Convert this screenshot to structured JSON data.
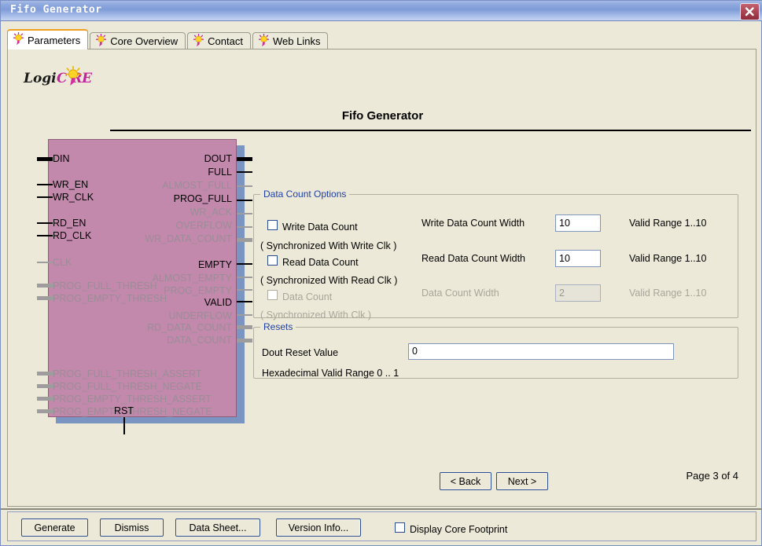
{
  "window": {
    "title": "Fifo Generator",
    "close_icon": "close-icon"
  },
  "tabs": [
    {
      "label": "Parameters",
      "icon": "bulb-icon",
      "selected": true
    },
    {
      "label": "Core Overview",
      "icon": "bulb-icon",
      "selected": false
    },
    {
      "label": "Contact",
      "icon": "bulb-icon",
      "selected": false
    },
    {
      "label": "Web Links",
      "icon": "bulb-icon",
      "selected": false
    }
  ],
  "logo": {
    "part1": "Logi",
    "part2": "C RE"
  },
  "header": {
    "title": "Fifo Generator"
  },
  "diagram": {
    "inputs": [
      {
        "label": "DIN",
        "enabled": true,
        "bus": true
      },
      {
        "label": "WR_EN",
        "enabled": true,
        "bus": false
      },
      {
        "label": "WR_CLK",
        "enabled": true,
        "bus": false
      },
      {
        "label": "RD_EN",
        "enabled": true,
        "bus": false
      },
      {
        "label": "RD_CLK",
        "enabled": true,
        "bus": false
      },
      {
        "label": "CLK",
        "enabled": false,
        "bus": false
      },
      {
        "label": "PROG_FULL_THRESH",
        "enabled": false,
        "bus": true
      },
      {
        "label": "PROG_EMPTY_THRESH",
        "enabled": false,
        "bus": true
      },
      {
        "label": "PROG_FULL_THRESH_ASSERT",
        "enabled": false,
        "bus": true
      },
      {
        "label": "PROG_FULL_THRESH_NEGATE",
        "enabled": false,
        "bus": true
      },
      {
        "label": "PROG_EMPTY_THRESH_ASSERT",
        "enabled": false,
        "bus": true
      },
      {
        "label": "PROG_EMPTY_THRESH_NEGATE",
        "enabled": false,
        "bus": true
      }
    ],
    "outputs": [
      {
        "label": "DOUT",
        "enabled": true,
        "bus": true
      },
      {
        "label": "FULL",
        "enabled": true,
        "bus": false
      },
      {
        "label": "ALMOST_FULL",
        "enabled": false,
        "bus": false
      },
      {
        "label": "PROG_FULL",
        "enabled": true,
        "bus": false
      },
      {
        "label": "WR_ACK",
        "enabled": false,
        "bus": false
      },
      {
        "label": "OVERFLOW",
        "enabled": false,
        "bus": false
      },
      {
        "label": "WR_DATA_COUNT",
        "enabled": false,
        "bus": true
      },
      {
        "label": "EMPTY",
        "enabled": true,
        "bus": false
      },
      {
        "label": "ALMOST_EMPTY",
        "enabled": false,
        "bus": false
      },
      {
        "label": "PROG_EMPTY",
        "enabled": false,
        "bus": false
      },
      {
        "label": "VALID",
        "enabled": true,
        "bus": false
      },
      {
        "label": "UNDERFLOW",
        "enabled": false,
        "bus": false
      },
      {
        "label": "RD_DATA_COUNT",
        "enabled": false,
        "bus": true
      },
      {
        "label": "DATA_COUNT",
        "enabled": false,
        "bus": true
      }
    ],
    "reset_pin": "RST"
  },
  "data_count_options": {
    "title": "Data Count Options",
    "write_data_count": {
      "checkbox_label": "Write Data Count",
      "checked": false,
      "enabled": true,
      "sync_note": "( Synchronized With Write Clk )",
      "width_label": "Write Data Count Width",
      "width_value": "10",
      "range_label": "Valid Range 1..10"
    },
    "read_data_count": {
      "checkbox_label": "Read Data Count",
      "checked": false,
      "enabled": true,
      "sync_note": "( Synchronized With Read Clk )",
      "width_label": "Read Data Count Width",
      "width_value": "10",
      "range_label": "Valid Range 1..10"
    },
    "data_count": {
      "checkbox_label": "Data Count",
      "checked": false,
      "enabled": false,
      "sync_note": "( Synchronized With Clk )",
      "width_label": "Data Count Width",
      "width_value": "2",
      "range_label": "Valid Range 1..10"
    }
  },
  "resets": {
    "title": "Resets",
    "dout_reset_label": "Dout Reset Value",
    "dout_reset_value": "0",
    "hex_range_label": "Hexadecimal Valid Range 0 .. 1"
  },
  "navigation": {
    "back_label": "< Back",
    "next_label": "Next >",
    "page_indicator": "Page 3 of 4"
  },
  "bottom_bar": {
    "generate_label": "Generate",
    "dismiss_label": "Dismiss",
    "data_sheet_label": "Data Sheet...",
    "version_info_label": "Version Info...",
    "footprint_checkbox_label": "Display Core Footprint",
    "footprint_checked": false
  },
  "colors": {
    "title_bar": "#8fa9de",
    "group_title": "#1f3fa8",
    "block_fill": "#c389ad",
    "block_shadow": "#7a95c2",
    "panel_bg": "#ece9d8",
    "accent_tab": "#f0a020",
    "close_button": "#b04a58"
  }
}
